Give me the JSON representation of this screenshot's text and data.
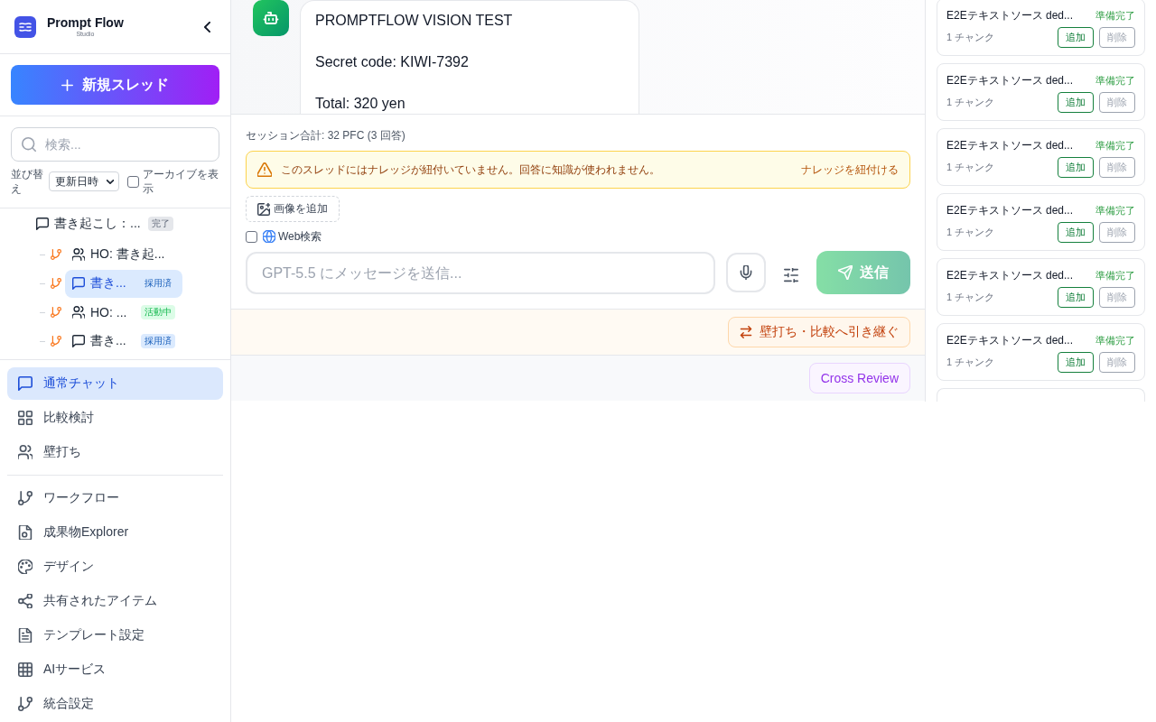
{
  "sidebar": {
    "brand": {
      "title": "Prompt Flow",
      "subtitle": "Studio"
    },
    "new_thread_button": "新規スレッド",
    "search": {
      "placeholder": "検索..."
    },
    "sort": {
      "label": "並び替え",
      "value": "更新日時"
    },
    "archive_filter": {
      "label": "アーカイブを表示",
      "checked": false
    },
    "tree": [
      {
        "kind": "chat",
        "label": "書き起こし：...",
        "badge": {
          "text": "完了",
          "color": "#e5e7eb"
        },
        "selected": false,
        "children": [
          {
            "kind": "people",
            "label": "HO: 書き起...",
            "selected": false
          },
          {
            "kind": "chat",
            "label": "書き...",
            "badge": {
              "text": "採用済",
              "color": "#dbeafe"
            },
            "selected": true
          },
          {
            "kind": "people",
            "label": "HO: ...",
            "badge": {
              "text": "活動中",
              "color": "#dcfce7"
            },
            "selected": false
          },
          {
            "kind": "chat",
            "label": "書き...",
            "badge": {
              "text": "採用済",
              "color": "#dbeafe"
            },
            "selected": false
          }
        ]
      }
    ],
    "nav_groups": [
      {
        "items": [
          {
            "kind": "chat",
            "label": "通常チャット",
            "selected": true
          },
          {
            "kind": "grid",
            "label": "比較検討",
            "selected": false
          },
          {
            "kind": "people",
            "label": "壁打ち",
            "selected": false
          }
        ]
      },
      {
        "items": [
          {
            "kind": "branch",
            "label": "ワークフロー",
            "selected": false
          },
          {
            "kind": "document",
            "label": "成果物Explorer",
            "selected": false
          },
          {
            "kind": "palette",
            "label": "デザイン",
            "selected": false
          },
          {
            "kind": "share",
            "label": "共有されたアイテム",
            "selected": false
          },
          {
            "kind": "file",
            "label": "テンプレート設定",
            "selected": false
          },
          {
            "kind": "table",
            "label": "AIサービス",
            "selected": false
          },
          {
            "kind": "branch",
            "label": "統合設定",
            "selected": false
          }
        ]
      }
    ]
  },
  "chat": {
    "message": {
      "paragraphs": [
        "PROMPTFLOW VISION TEST",
        "Secret code: KIWI-7392",
        "Total: 320 yen"
      ]
    },
    "session_total": "セッション合計: 32 PFC (3 回答)",
    "warning": {
      "text": "このスレッドにはナレッジが紐付いていません。回答に知識が使われません。",
      "action": "ナレッジを紐付ける"
    },
    "add_image_button": "画像を追加",
    "web_search": {
      "label": "Web検索",
      "checked": false
    },
    "message_input": {
      "placeholder": "GPT-5.5 にメッセージを送信..."
    },
    "send_button": {
      "label": "送信",
      "disabled": true
    },
    "handoff_button": "壁打ち・比較へ引き継ぐ",
    "cross_review_button": "Cross Review"
  },
  "knowledge_panel": {
    "sources": [
      {
        "title": "E2Eテキストソース ded...",
        "status": "準備完了",
        "chunks": "1 チャンク",
        "actions": [
          {
            "kind": "add",
            "label": "追加"
          },
          {
            "kind": "delete",
            "label": "削除"
          }
        ]
      },
      {
        "title": "E2Eテキストソース ded...",
        "status": "準備完了",
        "chunks": "1 チャンク",
        "actions": [
          {
            "kind": "add",
            "label": "追加"
          },
          {
            "kind": "delete",
            "label": "削除"
          }
        ]
      },
      {
        "title": "E2Eテキストソース ded...",
        "status": "準備完了",
        "chunks": "1 チャンク",
        "actions": [
          {
            "kind": "add",
            "label": "追加"
          },
          {
            "kind": "delete",
            "label": "削除"
          }
        ]
      },
      {
        "title": "E2Eテキストソース ded...",
        "status": "準備完了",
        "chunks": "1 チャンク",
        "actions": [
          {
            "kind": "add",
            "label": "追加"
          },
          {
            "kind": "delete",
            "label": "削除"
          }
        ]
      },
      {
        "title": "E2Eテキストソース ded...",
        "status": "準備完了",
        "chunks": "1 チャンク",
        "actions": [
          {
            "kind": "add",
            "label": "追加"
          },
          {
            "kind": "delete",
            "label": "削除"
          }
        ]
      },
      {
        "title": "E2Eテキストソース ded...",
        "status": "準備完了",
        "chunks": "1 チャンク",
        "actions": [
          {
            "kind": "add",
            "label": "追加"
          },
          {
            "kind": "delete",
            "label": "削除"
          }
        ]
      }
    ]
  }
}
